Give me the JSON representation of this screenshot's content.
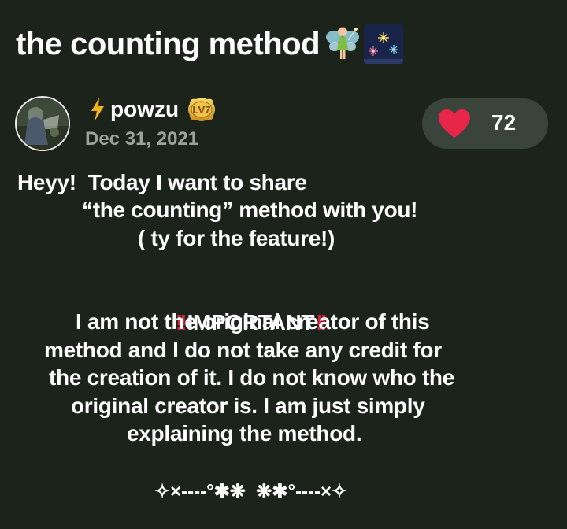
{
  "post": {
    "title": "the counting method",
    "title_emojis": [
      "fairy-icon",
      "fireworks-icon"
    ]
  },
  "author": {
    "name": "powzu",
    "level_badge": "LV7",
    "date": "Dec 31, 2021",
    "status_icon": "lightning-bolt-icon"
  },
  "likes": {
    "count": "72",
    "icon": "heart-icon",
    "heart_color": "#e8264a"
  },
  "body": {
    "line1": "Heyy!  Today I want to share",
    "line2": "“the counting” method with you!",
    "line3": "( ty for the feature!)",
    "important_label": "IMPORTANT",
    "important_icon": "double-exclamation-icon",
    "line5": "I am not the original creator of this",
    "line6": "method and I do not take any credit for",
    "line7": "the creation of it. I do not know who the",
    "line8": "original creator is. I am just simply",
    "line9": "explaining the method."
  },
  "ornament": "✧×----°✱❋  ❋✱°----×✧",
  "colors": {
    "background": "#1b231b",
    "pill": "#3a443a",
    "date": "#9aa49a",
    "alert": "#e0233a"
  }
}
